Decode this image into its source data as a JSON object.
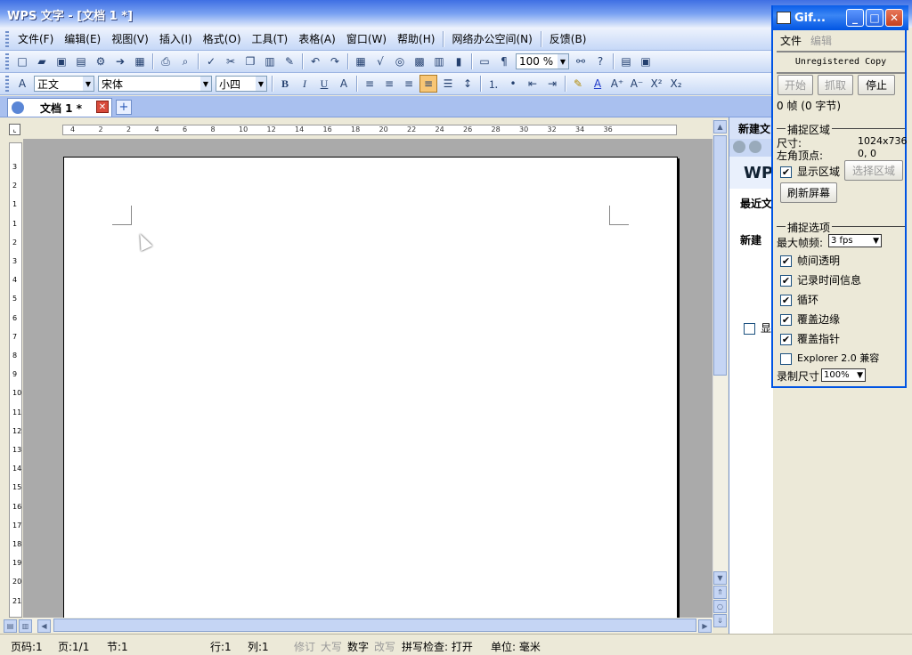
{
  "window": {
    "title": "WPS 文字 - [文档 1 *]"
  },
  "menu": [
    "文件(F)",
    "编辑(E)",
    "视图(V)",
    "插入(I)",
    "格式(O)",
    "工具(T)",
    "表格(A)",
    "窗口(W)",
    "帮助(H)",
    "网络办公空间(N)",
    "反馈(B)"
  ],
  "toolbar": {
    "zoom": "100 %"
  },
  "format": {
    "style": "正文",
    "font": "宋体",
    "size": "小四",
    "bold": "B",
    "italic": "I",
    "underline": "U"
  },
  "tab": {
    "name": "文档 1 *"
  },
  "ruler": {
    "h_ticks": [
      "4",
      "2",
      "2",
      "4",
      "6",
      "8",
      "10",
      "12",
      "14",
      "16",
      "18",
      "20",
      "22",
      "24",
      "26",
      "28",
      "30",
      "32",
      "34",
      "36"
    ],
    "v_ticks": [
      "3",
      "2",
      "1",
      "1",
      "2",
      "3",
      "4",
      "5",
      "6",
      "7",
      "8",
      "9",
      "10",
      "11",
      "12",
      "13",
      "14",
      "15",
      "16",
      "17",
      "18",
      "19",
      "20",
      "21"
    ]
  },
  "taskpane": {
    "header": "新建文",
    "logo": "WP",
    "recent": "最近文",
    "new": "新建",
    "show": "显"
  },
  "status": {
    "page_code": "页码:1",
    "page": "页:1/1",
    "section": "节:1",
    "row": "行:1",
    "col": "列:1",
    "revise": "修订",
    "caps": "大写",
    "num": "数字",
    "overwrite": "改写",
    "spell": "拼写检查: 打开",
    "unit": "单位: 毫米"
  },
  "gif": {
    "title": "Gif...",
    "menu_file": "文件",
    "menu_edit": "编辑",
    "unregistered": "Unregistered Copy",
    "start": "开始",
    "capture": "抓取",
    "stop": "停止",
    "frames": "0 帧 (0 字节)",
    "capture_region": "捕捉区域",
    "size_label": "尺寸:",
    "size_value": "1024x736",
    "corner_label": "左角顶点:",
    "corner_value": "0, 0",
    "show_region": "显示区域",
    "select_region": "选择区域",
    "refresh": "刷新屏幕",
    "capture_options": "捕捉选项",
    "max_fps_label": "最大帧频:",
    "max_fps": "3 fps",
    "opt1": "帧间透明",
    "opt2": "记录时间信息",
    "opt3": "循环",
    "opt4": "覆盖边缘",
    "opt5": "覆盖指针",
    "opt6": "Explorer 2.0 兼容",
    "record_size_label": "录制尺寸",
    "record_size": "100%"
  }
}
